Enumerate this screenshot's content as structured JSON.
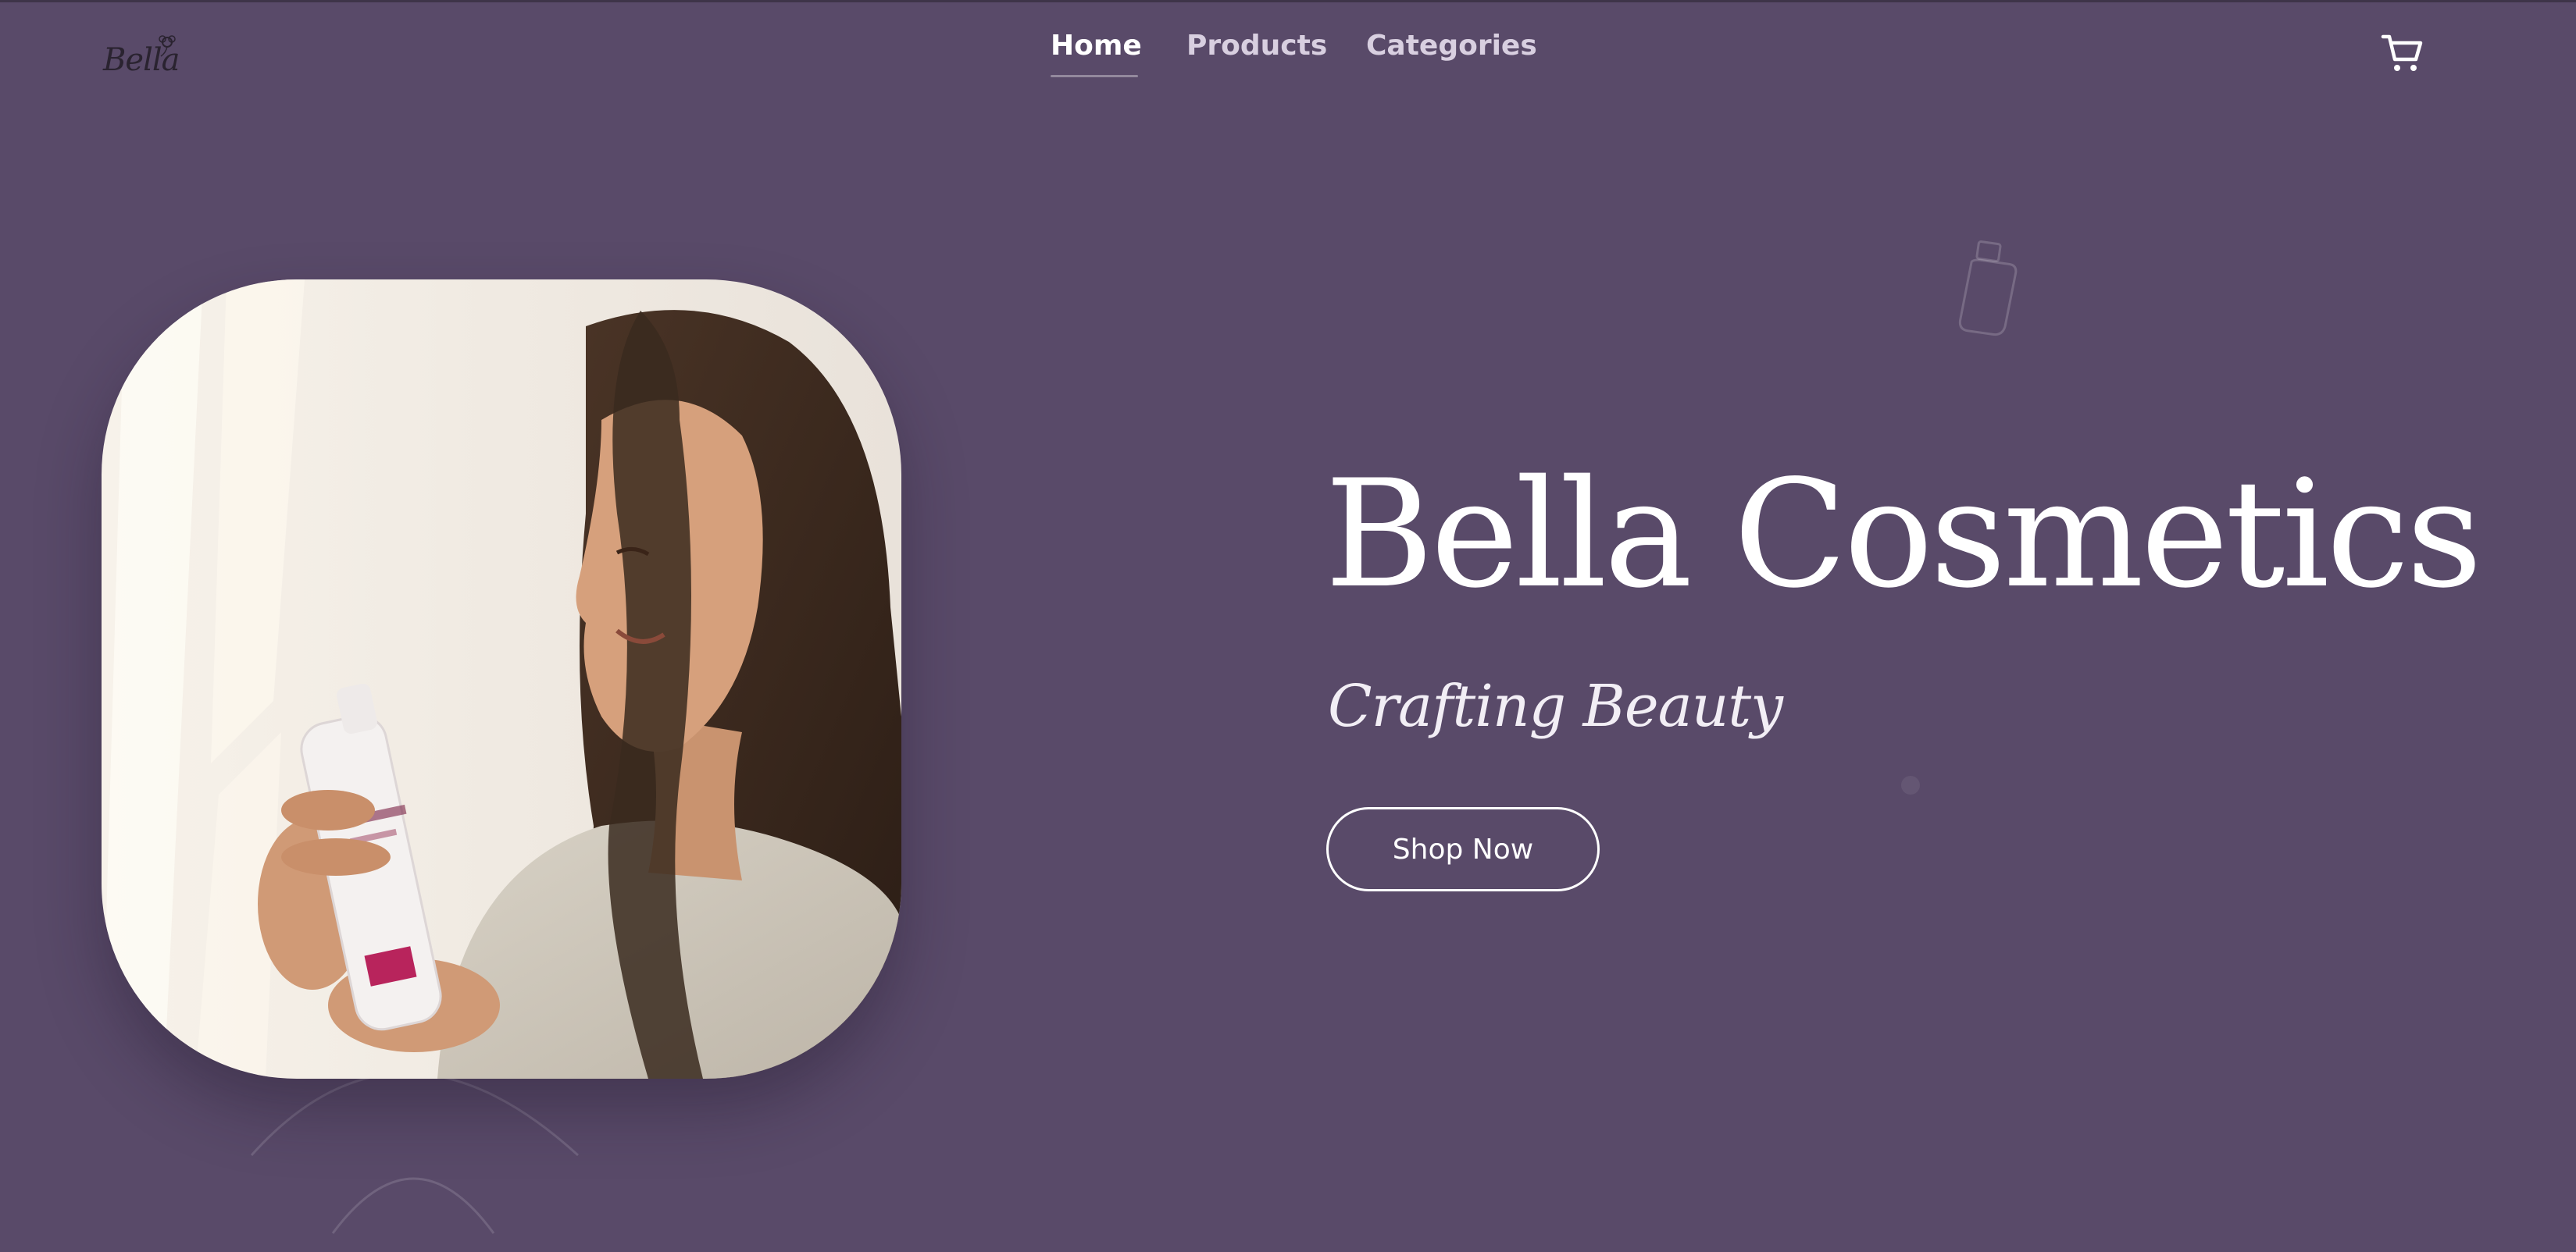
{
  "brand": {
    "logo_text": "Bella",
    "logo_icon": "flower-icon"
  },
  "nav": {
    "items": [
      {
        "label": "Home",
        "active": true
      },
      {
        "label": "Products",
        "active": false
      },
      {
        "label": "Categories",
        "active": false
      }
    ]
  },
  "header": {
    "cart_icon": "cart-icon"
  },
  "hero": {
    "title": "Bella Cosmetics",
    "subtitle": "Crafting Beauty",
    "cta_label": "Shop Now",
    "image_label": "woman holding a cosmetic spray bottle"
  },
  "colors": {
    "background": "#594a69",
    "text": "#ffffff",
    "nav_inactive": "#d8cfe0"
  }
}
